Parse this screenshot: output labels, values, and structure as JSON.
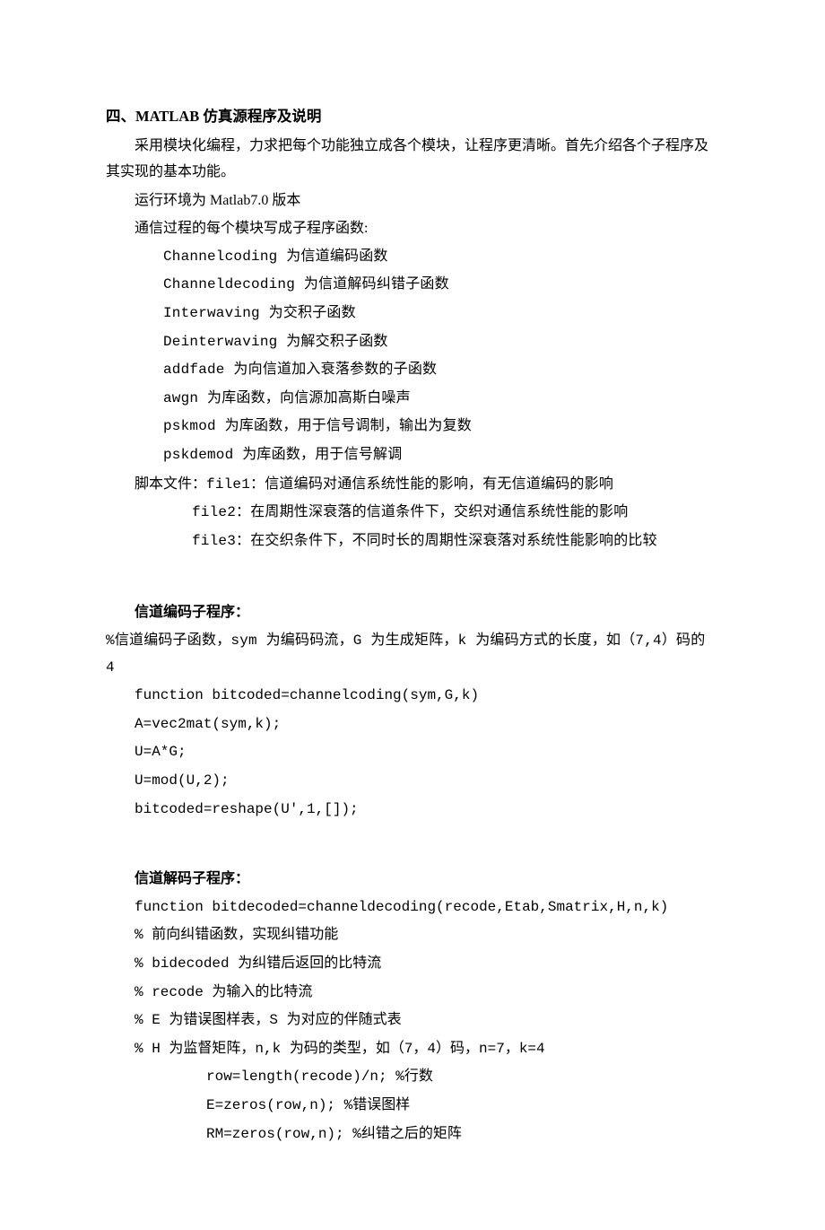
{
  "heading": "四、MATLAB 仿真源程序及说明",
  "intro1": "采用模块化编程，力求把每个功能独立成各个模块，让程序更清晰。首先介绍各个子程序及其实现的基本功能。",
  "intro2": "运行环境为 Matlab7.0 版本",
  "intro3": "通信过程的每个模块写成子程序函数:",
  "funcs": {
    "f1": "Channelcoding 为信道编码函数",
    "f2": "Channeldecoding  为信道解码纠错子函数",
    "f3": "Interwaving  为交积子函数",
    "f4": "Deinterwaving  为解交积子函数",
    "f5": "addfade 为向信道加入衰落参数的子函数",
    "f6": "awgn   为库函数，向信源加高斯白噪声",
    "f7": "pskmod  为库函数，用于信号调制，输出为复数",
    "f8": "pskdemod  为库函数，用于信号解调"
  },
  "scripts_label": "脚本文件：",
  "scripts": {
    "s1": "file1：信道编码对通信系统性能的影响，有无信道编码的影响",
    "s2": "file2：在周期性深衰落的信道条件下，交织对通信系统性能的影响",
    "s3": "file3：在交织条件下，不同时长的周期性深衰落对系统性能影响的比较"
  },
  "enc_heading": "信道编码子程序：",
  "enc_comment": "%信道编码子函数，sym 为编码码流，G 为生成矩阵，k 为编码方式的长度，如（7,4）码的 4",
  "enc": {
    "l1": "function bitcoded=channelcoding(sym,G,k)",
    "l2": "A=vec2mat(sym,k);",
    "l3": "U=A*G;",
    "l4": "U=mod(U,2);",
    "l5": "bitcoded=reshape(U',1,[]);"
  },
  "dec_heading": "信道解码子程序：",
  "dec": {
    "l1": "function bitdecoded=channeldecoding(recode,Etab,Smatrix,H,n,k)",
    "l2": "% 前向纠错函数，实现纠错功能",
    "l3": "% bidecoded 为纠错后返回的比特流",
    "l4": "% recode 为输入的比特流",
    "l5": "% E 为错误图样表，S 为对应的伴随式表",
    "l6": "% H 为监督矩阵，n,k 为码的类型，如（7，4）码，n=7，k=4",
    "l7": "row=length(recode)/n;  %行数",
    "l8": "E=zeros(row,n);  %错误图样",
    "l9": "RM=zeros(row,n); %纠错之后的矩阵"
  }
}
